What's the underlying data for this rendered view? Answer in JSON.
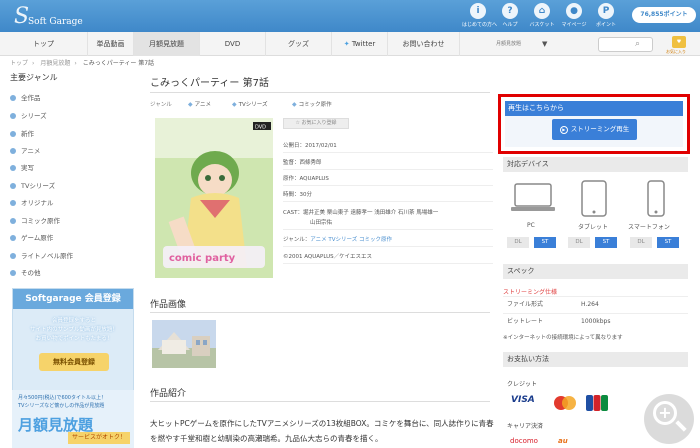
{
  "header": {
    "logo": "Soft Garage",
    "icons": [
      {
        "icon": "info-icon",
        "label": "はじめての方へ"
      },
      {
        "icon": "help-icon",
        "label": "ヘルプ"
      },
      {
        "icon": "basket-icon",
        "label": "バスケット"
      },
      {
        "icon": "user-icon",
        "label": "マイページ"
      },
      {
        "icon": "point-icon",
        "label": "ポイント"
      }
    ],
    "points": "76,855ポイント"
  },
  "nav": {
    "items": [
      "トップ",
      "単品動画",
      "月額見放題",
      "DVD",
      "グッズ",
      "Twitter",
      "お問い合わせ"
    ],
    "active": "月額見放題",
    "select_value": "月額見放題",
    "cart_label": "お気に入り"
  },
  "breadcrumb": [
    "トップ",
    "月額見放題",
    "こみっくパーティー 第7話"
  ],
  "sidebar": {
    "title": "主要ジャンル",
    "items": [
      "全作品",
      "シリーズ",
      "新作",
      "アニメ",
      "実写",
      "TVシリーズ",
      "オリジナル",
      "コミック原作",
      "ゲーム原作",
      "ライトノベル原作",
      "その他"
    ],
    "banner1": {
      "title": "Softgarage 会員登録",
      "line1": "会員登録をすると",
      "line2": "サイト内のサンプル動画が見放題！",
      "line3": "お買い物でポイントもたまる！",
      "button": "無料会員登録"
    },
    "banner2": {
      "line1": "月々500円(税込)で600タイトル以上！",
      "line2": "TVシリーズなど懐かしの作品が見放題",
      "title": "月額見放題",
      "sub": "サービスがオトク！"
    }
  },
  "main": {
    "title": "こみっくパーティー 第7話",
    "tag_label": "ジャンル",
    "tags": [
      "アニメ",
      "TVシリーズ",
      "コミック原作"
    ],
    "fav_button": "お気に入り登録",
    "info": {
      "release_label": "公開日：",
      "release": "2017/02/01",
      "director_label": "監督：",
      "director": "西條秀郎",
      "original_label": "原作：",
      "original": "AQUAPLUS",
      "time_label": "時間：",
      "time": "30分",
      "cast_label": "CAST：",
      "cast_line1": "堀井正美 栗山東子 遠藤孝一 浅田雄介 石川茶 馬場雄一",
      "cast_line2": "山田宗佑",
      "genre_label": "ジャンル：",
      "genre_links": [
        "アニメ",
        "TVシリーズ",
        "コミック原作"
      ],
      "copyright": "©2001 AQUAPLUS／ケイエスエス"
    },
    "section_images": "作品画像",
    "section_intro": "作品紹介",
    "description": "大ヒットPCゲームを原作にしたTVアニメシリーズの13枚組BOX。コミケを舞台に、同人誌作りに青春を燃やす千堂和樹と幼馴染の高瀬瑞希。九品仏大志らの青春を描く。"
  },
  "right": {
    "play_title": "再生はこちらから",
    "stream_button": "ストリーミング再生",
    "device_title": "対応デバイス",
    "devices": [
      {
        "name": "PC",
        "dl": "DL",
        "st": "ST"
      },
      {
        "name": "タブレット",
        "dl": "DL",
        "st": "ST"
      },
      {
        "name": "スマートフォン",
        "dl": "DL",
        "st": "ST"
      }
    ],
    "spec_title": "スペック",
    "spec_red": "ストリーミング仕様",
    "spec_rows": [
      {
        "key": "ファイル形式",
        "value": "H.264"
      },
      {
        "key": "ビットレート",
        "value": "1000kbps"
      }
    ],
    "spec_note": "※インターネットの接続環境によって異なります",
    "pay_title": "お支払い方法",
    "credit_label": "クレジット",
    "card_logos": [
      "VISA",
      "MC",
      "JCB"
    ],
    "carrier_label": "キャリア決済",
    "carriers": [
      "docomo",
      "au"
    ]
  }
}
